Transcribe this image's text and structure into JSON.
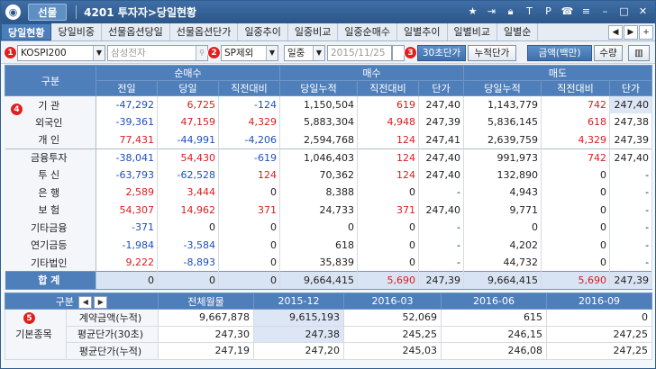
{
  "titlebar": {
    "tab": "선물",
    "title": "4201 투자자>당일현황"
  },
  "tabs": [
    "당일현황",
    "당일비중",
    "선물옵션당일",
    "선물옵션단가",
    "일중추이",
    "일중비교",
    "일중순매수",
    "일별추이",
    "일별비교",
    "일별순"
  ],
  "toolbar": {
    "market": "KOSPI200",
    "stock_placeholder": "삼성전자",
    "filter": "SP제외",
    "period": "일중",
    "date": "2015/11/25",
    "interval_btn": "30초단가",
    "cumul_btn": "누적단가",
    "amount_btn": "금액(백만)",
    "qty_btn": "수량"
  },
  "badges": [
    "1",
    "2",
    "3",
    "4",
    "5"
  ],
  "grid1": {
    "group_headers": [
      "구분",
      "순매수",
      "매수",
      "매도"
    ],
    "columns": [
      "전일",
      "당일",
      "직전대비",
      "당일누적",
      "직전대비",
      "단가",
      "당일누적",
      "직전대비",
      "단가"
    ],
    "rows": [
      {
        "label": "기 관",
        "cells": [
          "-47,292",
          "6,725",
          "-124",
          "1,150,504",
          "619",
          "247,40",
          "1,143,779",
          "742",
          "247,40"
        ],
        "cls": [
          "neg",
          "pos",
          "neg",
          "",
          "pos",
          "",
          "",
          "pos",
          ""
        ]
      },
      {
        "label": "외국인",
        "cells": [
          "-39,361",
          "47,159",
          "4,329",
          "5,883,304",
          "4,948",
          "247,39",
          "5,836,145",
          "618",
          "247,38"
        ],
        "cls": [
          "neg",
          "pos",
          "pos",
          "",
          "pos",
          "",
          "",
          "pos",
          ""
        ]
      },
      {
        "label": "개 인",
        "cells": [
          "77,431",
          "-44,991",
          "-4,206",
          "2,594,768",
          "124",
          "247,41",
          "2,639,759",
          "4,329",
          "247,39"
        ],
        "cls": [
          "pos",
          "neg",
          "neg",
          "",
          "pos",
          "",
          "",
          "pos",
          ""
        ]
      },
      {
        "label": "금융투자",
        "cells": [
          "-38,041",
          "54,430",
          "-619",
          "1,046,403",
          "124",
          "247,40",
          "991,973",
          "742",
          "247,40"
        ],
        "cls": [
          "neg",
          "pos",
          "neg",
          "",
          "pos",
          "",
          "",
          "pos",
          ""
        ]
      },
      {
        "label": "투 신",
        "cells": [
          "-63,793",
          "-62,528",
          "124",
          "70,362",
          "124",
          "247,40",
          "132,890",
          "0",
          "-"
        ],
        "cls": [
          "neg",
          "neg",
          "pos",
          "",
          "pos",
          "",
          "",
          "",
          ""
        ]
      },
      {
        "label": "은 행",
        "cells": [
          "2,589",
          "3,444",
          "0",
          "8,388",
          "0",
          "-",
          "4,943",
          "0",
          "-"
        ],
        "cls": [
          "pos",
          "pos",
          "",
          "",
          "",
          "",
          "",
          "",
          ""
        ]
      },
      {
        "label": "보 험",
        "cells": [
          "54,307",
          "14,962",
          "371",
          "24,733",
          "371",
          "247,40",
          "9,771",
          "0",
          "-"
        ],
        "cls": [
          "pos",
          "pos",
          "pos",
          "",
          "pos",
          "",
          "",
          "",
          ""
        ]
      },
      {
        "label": "기타금융",
        "cells": [
          "-371",
          "0",
          "0",
          "0",
          "0",
          "-",
          "0",
          "0",
          "-"
        ],
        "cls": [
          "neg",
          "",
          "",
          "",
          "",
          "",
          "",
          "",
          ""
        ]
      },
      {
        "label": "연기금등",
        "cells": [
          "-1,984",
          "-3,584",
          "0",
          "618",
          "0",
          "-",
          "4,202",
          "0",
          "-"
        ],
        "cls": [
          "neg",
          "neg",
          "",
          "",
          "",
          "",
          "",
          "",
          ""
        ]
      },
      {
        "label": "기타법인",
        "cells": [
          "9,222",
          "-8,893",
          "0",
          "35,839",
          "0",
          "-",
          "44,732",
          "0",
          "-"
        ],
        "cls": [
          "pos",
          "neg",
          "",
          "",
          "",
          "",
          "",
          "",
          ""
        ]
      }
    ],
    "total": {
      "label": "합 계",
      "cells": [
        "0",
        "0",
        "0",
        "9,664,415",
        "5,690",
        "247,39",
        "9,664,415",
        "5,690",
        "247,39"
      ],
      "cls": [
        "",
        "",
        "",
        "",
        "pos",
        "",
        "",
        "pos",
        ""
      ]
    }
  },
  "grid2": {
    "headers": [
      "구분",
      "전체월물",
      "2015-12",
      "2016-03",
      "2016-06",
      "2016-09"
    ],
    "group_label": "기본종목",
    "rows": [
      {
        "label": "계약금액(누적)",
        "cells": [
          "9,667,878",
          "9,615,193",
          "52,069",
          "615",
          "0"
        ]
      },
      {
        "label": "평균단가(30초)",
        "cells": [
          "247,30",
          "247,38",
          "245,25",
          "246,15",
          "247,25"
        ]
      },
      {
        "label": "평균단가(누적)",
        "cells": [
          "247,19",
          "247,20",
          "245,03",
          "246,08",
          "247,25"
        ]
      }
    ]
  }
}
